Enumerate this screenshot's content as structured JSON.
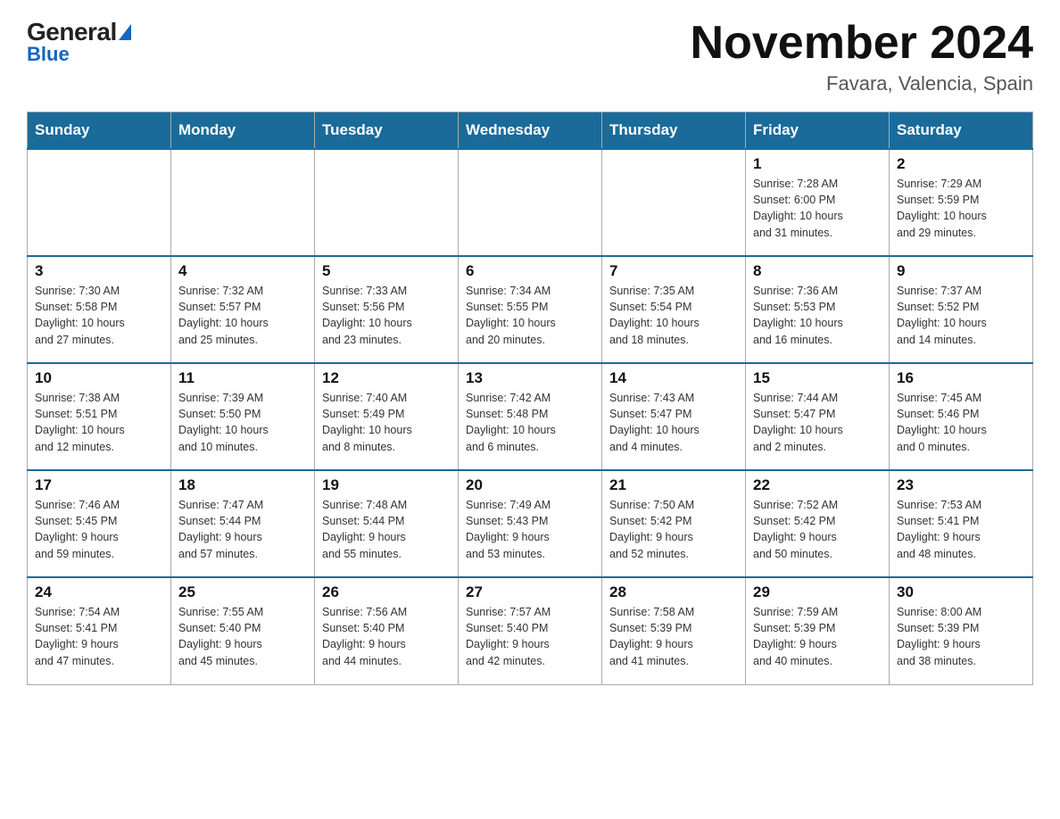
{
  "header": {
    "logo_general": "General",
    "logo_blue": "Blue",
    "title": "November 2024",
    "subtitle": "Favara, Valencia, Spain"
  },
  "days_header": [
    "Sunday",
    "Monday",
    "Tuesday",
    "Wednesday",
    "Thursday",
    "Friday",
    "Saturday"
  ],
  "weeks": [
    [
      {
        "day": "",
        "info": "",
        "empty": true
      },
      {
        "day": "",
        "info": "",
        "empty": true
      },
      {
        "day": "",
        "info": "",
        "empty": true
      },
      {
        "day": "",
        "info": "",
        "empty": true
      },
      {
        "day": "",
        "info": "",
        "empty": true
      },
      {
        "day": "1",
        "info": "Sunrise: 7:28 AM\nSunset: 6:00 PM\nDaylight: 10 hours\nand 31 minutes."
      },
      {
        "day": "2",
        "info": "Sunrise: 7:29 AM\nSunset: 5:59 PM\nDaylight: 10 hours\nand 29 minutes."
      }
    ],
    [
      {
        "day": "3",
        "info": "Sunrise: 7:30 AM\nSunset: 5:58 PM\nDaylight: 10 hours\nand 27 minutes."
      },
      {
        "day": "4",
        "info": "Sunrise: 7:32 AM\nSunset: 5:57 PM\nDaylight: 10 hours\nand 25 minutes."
      },
      {
        "day": "5",
        "info": "Sunrise: 7:33 AM\nSunset: 5:56 PM\nDaylight: 10 hours\nand 23 minutes."
      },
      {
        "day": "6",
        "info": "Sunrise: 7:34 AM\nSunset: 5:55 PM\nDaylight: 10 hours\nand 20 minutes."
      },
      {
        "day": "7",
        "info": "Sunrise: 7:35 AM\nSunset: 5:54 PM\nDaylight: 10 hours\nand 18 minutes."
      },
      {
        "day": "8",
        "info": "Sunrise: 7:36 AM\nSunset: 5:53 PM\nDaylight: 10 hours\nand 16 minutes."
      },
      {
        "day": "9",
        "info": "Sunrise: 7:37 AM\nSunset: 5:52 PM\nDaylight: 10 hours\nand 14 minutes."
      }
    ],
    [
      {
        "day": "10",
        "info": "Sunrise: 7:38 AM\nSunset: 5:51 PM\nDaylight: 10 hours\nand 12 minutes."
      },
      {
        "day": "11",
        "info": "Sunrise: 7:39 AM\nSunset: 5:50 PM\nDaylight: 10 hours\nand 10 minutes."
      },
      {
        "day": "12",
        "info": "Sunrise: 7:40 AM\nSunset: 5:49 PM\nDaylight: 10 hours\nand 8 minutes."
      },
      {
        "day": "13",
        "info": "Sunrise: 7:42 AM\nSunset: 5:48 PM\nDaylight: 10 hours\nand 6 minutes."
      },
      {
        "day": "14",
        "info": "Sunrise: 7:43 AM\nSunset: 5:47 PM\nDaylight: 10 hours\nand 4 minutes."
      },
      {
        "day": "15",
        "info": "Sunrise: 7:44 AM\nSunset: 5:47 PM\nDaylight: 10 hours\nand 2 minutes."
      },
      {
        "day": "16",
        "info": "Sunrise: 7:45 AM\nSunset: 5:46 PM\nDaylight: 10 hours\nand 0 minutes."
      }
    ],
    [
      {
        "day": "17",
        "info": "Sunrise: 7:46 AM\nSunset: 5:45 PM\nDaylight: 9 hours\nand 59 minutes."
      },
      {
        "day": "18",
        "info": "Sunrise: 7:47 AM\nSunset: 5:44 PM\nDaylight: 9 hours\nand 57 minutes."
      },
      {
        "day": "19",
        "info": "Sunrise: 7:48 AM\nSunset: 5:44 PM\nDaylight: 9 hours\nand 55 minutes."
      },
      {
        "day": "20",
        "info": "Sunrise: 7:49 AM\nSunset: 5:43 PM\nDaylight: 9 hours\nand 53 minutes."
      },
      {
        "day": "21",
        "info": "Sunrise: 7:50 AM\nSunset: 5:42 PM\nDaylight: 9 hours\nand 52 minutes."
      },
      {
        "day": "22",
        "info": "Sunrise: 7:52 AM\nSunset: 5:42 PM\nDaylight: 9 hours\nand 50 minutes."
      },
      {
        "day": "23",
        "info": "Sunrise: 7:53 AM\nSunset: 5:41 PM\nDaylight: 9 hours\nand 48 minutes."
      }
    ],
    [
      {
        "day": "24",
        "info": "Sunrise: 7:54 AM\nSunset: 5:41 PM\nDaylight: 9 hours\nand 47 minutes."
      },
      {
        "day": "25",
        "info": "Sunrise: 7:55 AM\nSunset: 5:40 PM\nDaylight: 9 hours\nand 45 minutes."
      },
      {
        "day": "26",
        "info": "Sunrise: 7:56 AM\nSunset: 5:40 PM\nDaylight: 9 hours\nand 44 minutes."
      },
      {
        "day": "27",
        "info": "Sunrise: 7:57 AM\nSunset: 5:40 PM\nDaylight: 9 hours\nand 42 minutes."
      },
      {
        "day": "28",
        "info": "Sunrise: 7:58 AM\nSunset: 5:39 PM\nDaylight: 9 hours\nand 41 minutes."
      },
      {
        "day": "29",
        "info": "Sunrise: 7:59 AM\nSunset: 5:39 PM\nDaylight: 9 hours\nand 40 minutes."
      },
      {
        "day": "30",
        "info": "Sunrise: 8:00 AM\nSunset: 5:39 PM\nDaylight: 9 hours\nand 38 minutes."
      }
    ]
  ]
}
